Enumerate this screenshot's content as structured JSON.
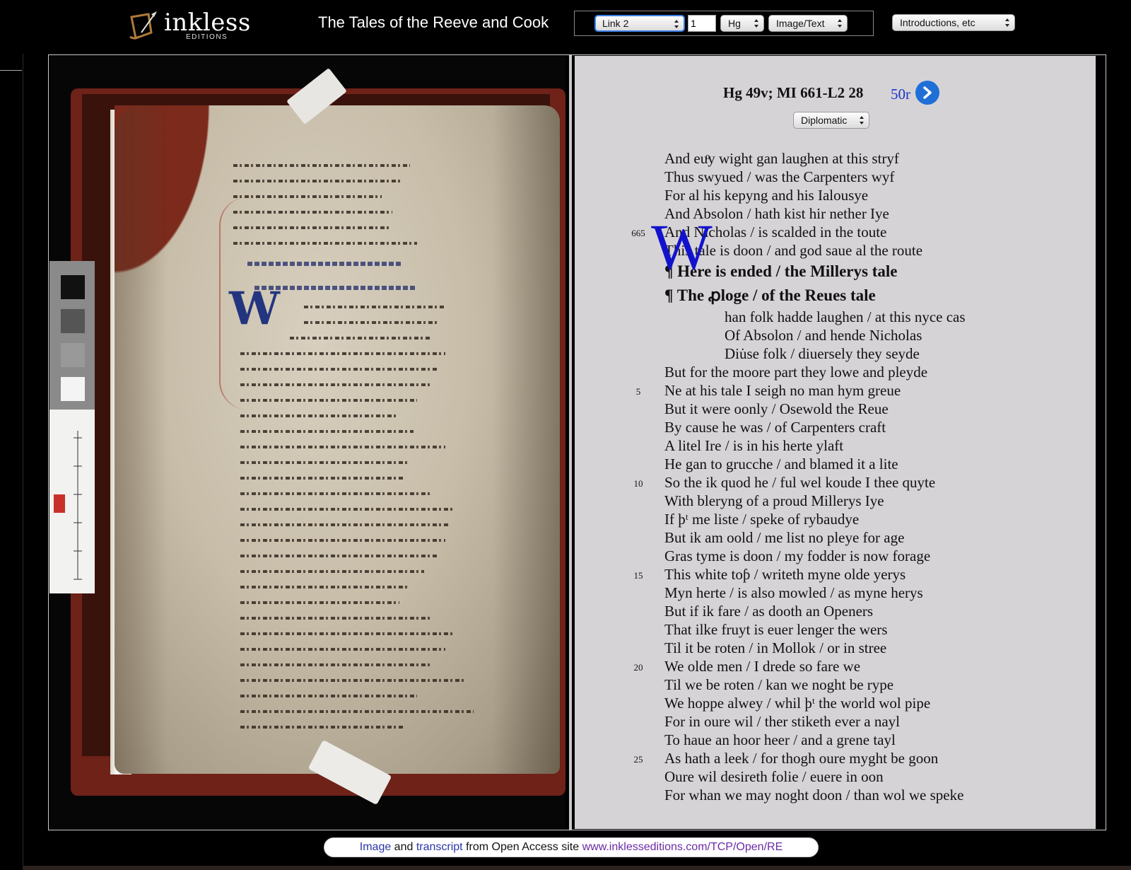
{
  "header": {
    "logo_text": "inkless",
    "logo_sub": "EDITIONS",
    "title": "The Tales of the Reeve and Cook",
    "nav": {
      "link_select": "Link 2",
      "line_input": "1",
      "ms_select": "Hg",
      "view_select": "Image/Text"
    },
    "intro_select": "Introductions, etc"
  },
  "text_panel": {
    "folio_heading": "Hg 49v; MI 661-L2 28",
    "next_folio": "50r",
    "transcription_select": "Diplomatic",
    "drop_cap": "W",
    "lines": [
      {
        "num": "",
        "text": "And euͦy wight gan laughen at this stryf"
      },
      {
        "num": "",
        "text": "Thus swyued / was the Carpenters wyf"
      },
      {
        "num": "",
        "text": "For al his kepyng and his Ialousye"
      },
      {
        "num": "",
        "text": "And Absolon / hath kist hir nether Iye"
      },
      {
        "num": "665",
        "text": "And Nicholas / is scalded in the toute"
      },
      {
        "num": "",
        "text": "This tale is doon / and god saue al the route"
      },
      {
        "num": "",
        "text": "¶ Here is ended / the Millerys tale",
        "head": true
      },
      {
        "num": "",
        "text": "¶ The ꝓloge / of the Reues tale",
        "head": true
      },
      {
        "num": "",
        "text": "han folk hadde laughen / at this nyce cas",
        "indent": true
      },
      {
        "num": "",
        "text": "Of Absolon / and hende Nicholas",
        "indent": true
      },
      {
        "num": "",
        "text": "Diu̇se folk / diuersely they seyde",
        "indent": true
      },
      {
        "num": "",
        "text": "But for the moore part they lowe and pleyde"
      },
      {
        "num": "5",
        "text": "Ne at his tale I seigh no man hym greue"
      },
      {
        "num": "",
        "text": "But it were oonly / Osewold the Reue"
      },
      {
        "num": "",
        "text": "By cause he was / of Carpenters craft"
      },
      {
        "num": "",
        "text": "A litel Ire / is in his herte ylaft"
      },
      {
        "num": "",
        "text": "He gan to grucche / and blamed it a lite"
      },
      {
        "num": "10",
        "text": "So the ik quod he / ful wel koude I thee quyte"
      },
      {
        "num": "",
        "text": "With bleryng of a proud Millerys Iye"
      },
      {
        "num": "",
        "text": "If þᵗ me liste / speke of rybaudye"
      },
      {
        "num": "",
        "text": "But ik am oold / me list no pleye for age"
      },
      {
        "num": "",
        "text": "Gras tyme is doon / my fodder is now forage"
      },
      {
        "num": "15",
        "text": "This white toƥ / writeth myne olde yerys"
      },
      {
        "num": "",
        "text": "Myn herte / is also mowled / as myne herys"
      },
      {
        "num": "",
        "text": "But if ik fare / as dooth an Openers"
      },
      {
        "num": "",
        "text": "That ilke fruyt is euer lenger the wers"
      },
      {
        "num": "",
        "text": "Til it be roten / in Mollok / or in stree"
      },
      {
        "num": "20",
        "text": "We olde men / I drede so fare we"
      },
      {
        "num": "",
        "text": "Til we be roten / kan we noght be rype"
      },
      {
        "num": "",
        "text": "We hoppe alwey / whil þᵗ the world wol pipe"
      },
      {
        "num": "",
        "text": "For in oure wil / ther stiketh ever a nayl"
      },
      {
        "num": "",
        "text": "To haue an hoor heer / and a grene tayl"
      },
      {
        "num": "25",
        "text": "As hath a leek / for thogh oure myght be goon"
      },
      {
        "num": "",
        "text": "Oure wil desireth folie / euere in oon"
      },
      {
        "num": "",
        "text": "For whan we may noght doon / than wol we speke"
      }
    ]
  },
  "footer": {
    "image_link": "Image",
    "and": " and ",
    "transcript_link": "transcript",
    "from_text": " from Open Access site ",
    "site_link": "www.inklesseditions.com/TCP/Open/RE"
  },
  "colors": {
    "accent_blue": "#1f6fd6",
    "drop_cap_blue": "#1212cc",
    "folio_link": "#1b34c8",
    "panel_bg": "#d6d3d7"
  },
  "icons": {
    "next_page": "chevron-right-icon",
    "select_arrows": "up-down-arrows-icon",
    "logo": "quill-scroll-icon"
  }
}
